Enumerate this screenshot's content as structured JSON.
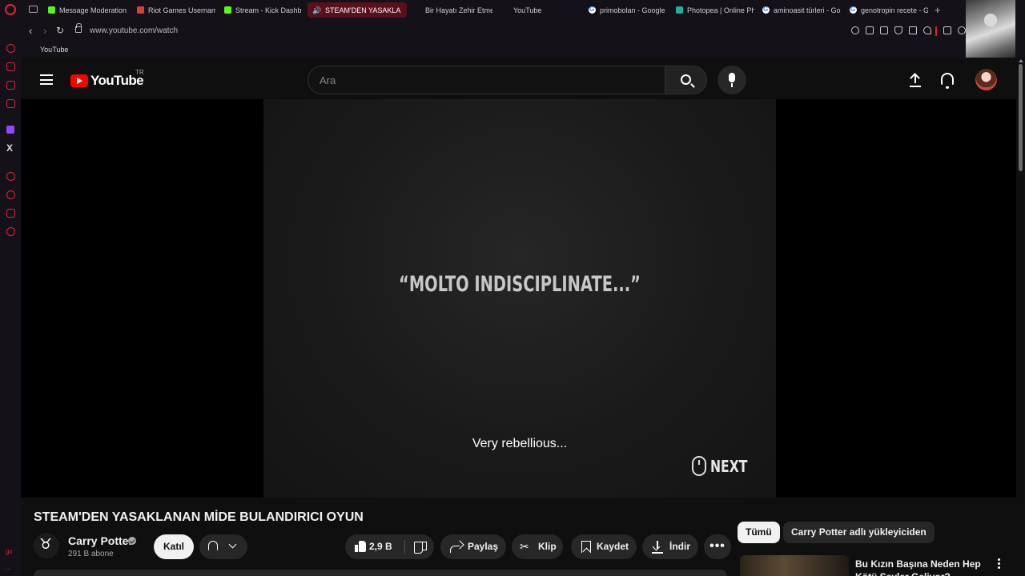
{
  "browser": {
    "tabs": [
      {
        "label": "Message Moderation",
        "icon": "kick-favicon"
      },
      {
        "label": "Riot Games Usernam",
        "icon": "riot-favicon"
      },
      {
        "label": "Stream - Kick Dashb",
        "icon": "kick-favicon"
      },
      {
        "label": "STEAM'DEN YASAKLA",
        "icon": "speaker-icon",
        "active": true
      },
      {
        "label": "Bir Hayatı Zehir Etme",
        "icon": "youtube-favicon"
      },
      {
        "label": "YouTube",
        "icon": "youtube-favicon"
      },
      {
        "label": "primobolan - Google",
        "icon": "google-favicon"
      },
      {
        "label": "Photopea | Online Ph",
        "icon": "photopea-favicon"
      },
      {
        "label": "aminoasit türleri - Go",
        "icon": "google-favicon"
      },
      {
        "label": "genotropin recete - G",
        "icon": "google-favicon"
      }
    ],
    "new_tab": "+",
    "url": "www.youtube.com/watch",
    "bookmarks": [
      {
        "label": "YouTube",
        "icon": "youtube-favicon"
      }
    ],
    "accent_color": "#e0223b"
  },
  "youtube": {
    "logo_text": "YouTube",
    "country_code": "TR",
    "search_placeholder": "Ara",
    "video": {
      "quote_text": "“MOLTO INDISCIPLINATE...”",
      "subtitle": "Very rebellious...",
      "next_label": "NEXT"
    },
    "title": "STEAM'DEN YASAKLANAN MİDE BULANDIRICI OYUN",
    "channel": {
      "name": "Carry Potter",
      "subscribers": "291 B abone",
      "join_label": "Katıl"
    },
    "actions": {
      "likes": "2,9 B",
      "share": "Paylaş",
      "clip": "Klip",
      "save": "Kaydet",
      "download": "İndir",
      "more": "•••"
    },
    "filter_chips": [
      "Tümü",
      "Carry Potter adlı yükleyiciden"
    ],
    "recommendation": {
      "title": "Bu Kızın Başına Neden Hep Kötü Şeyler Geliyor?"
    }
  }
}
